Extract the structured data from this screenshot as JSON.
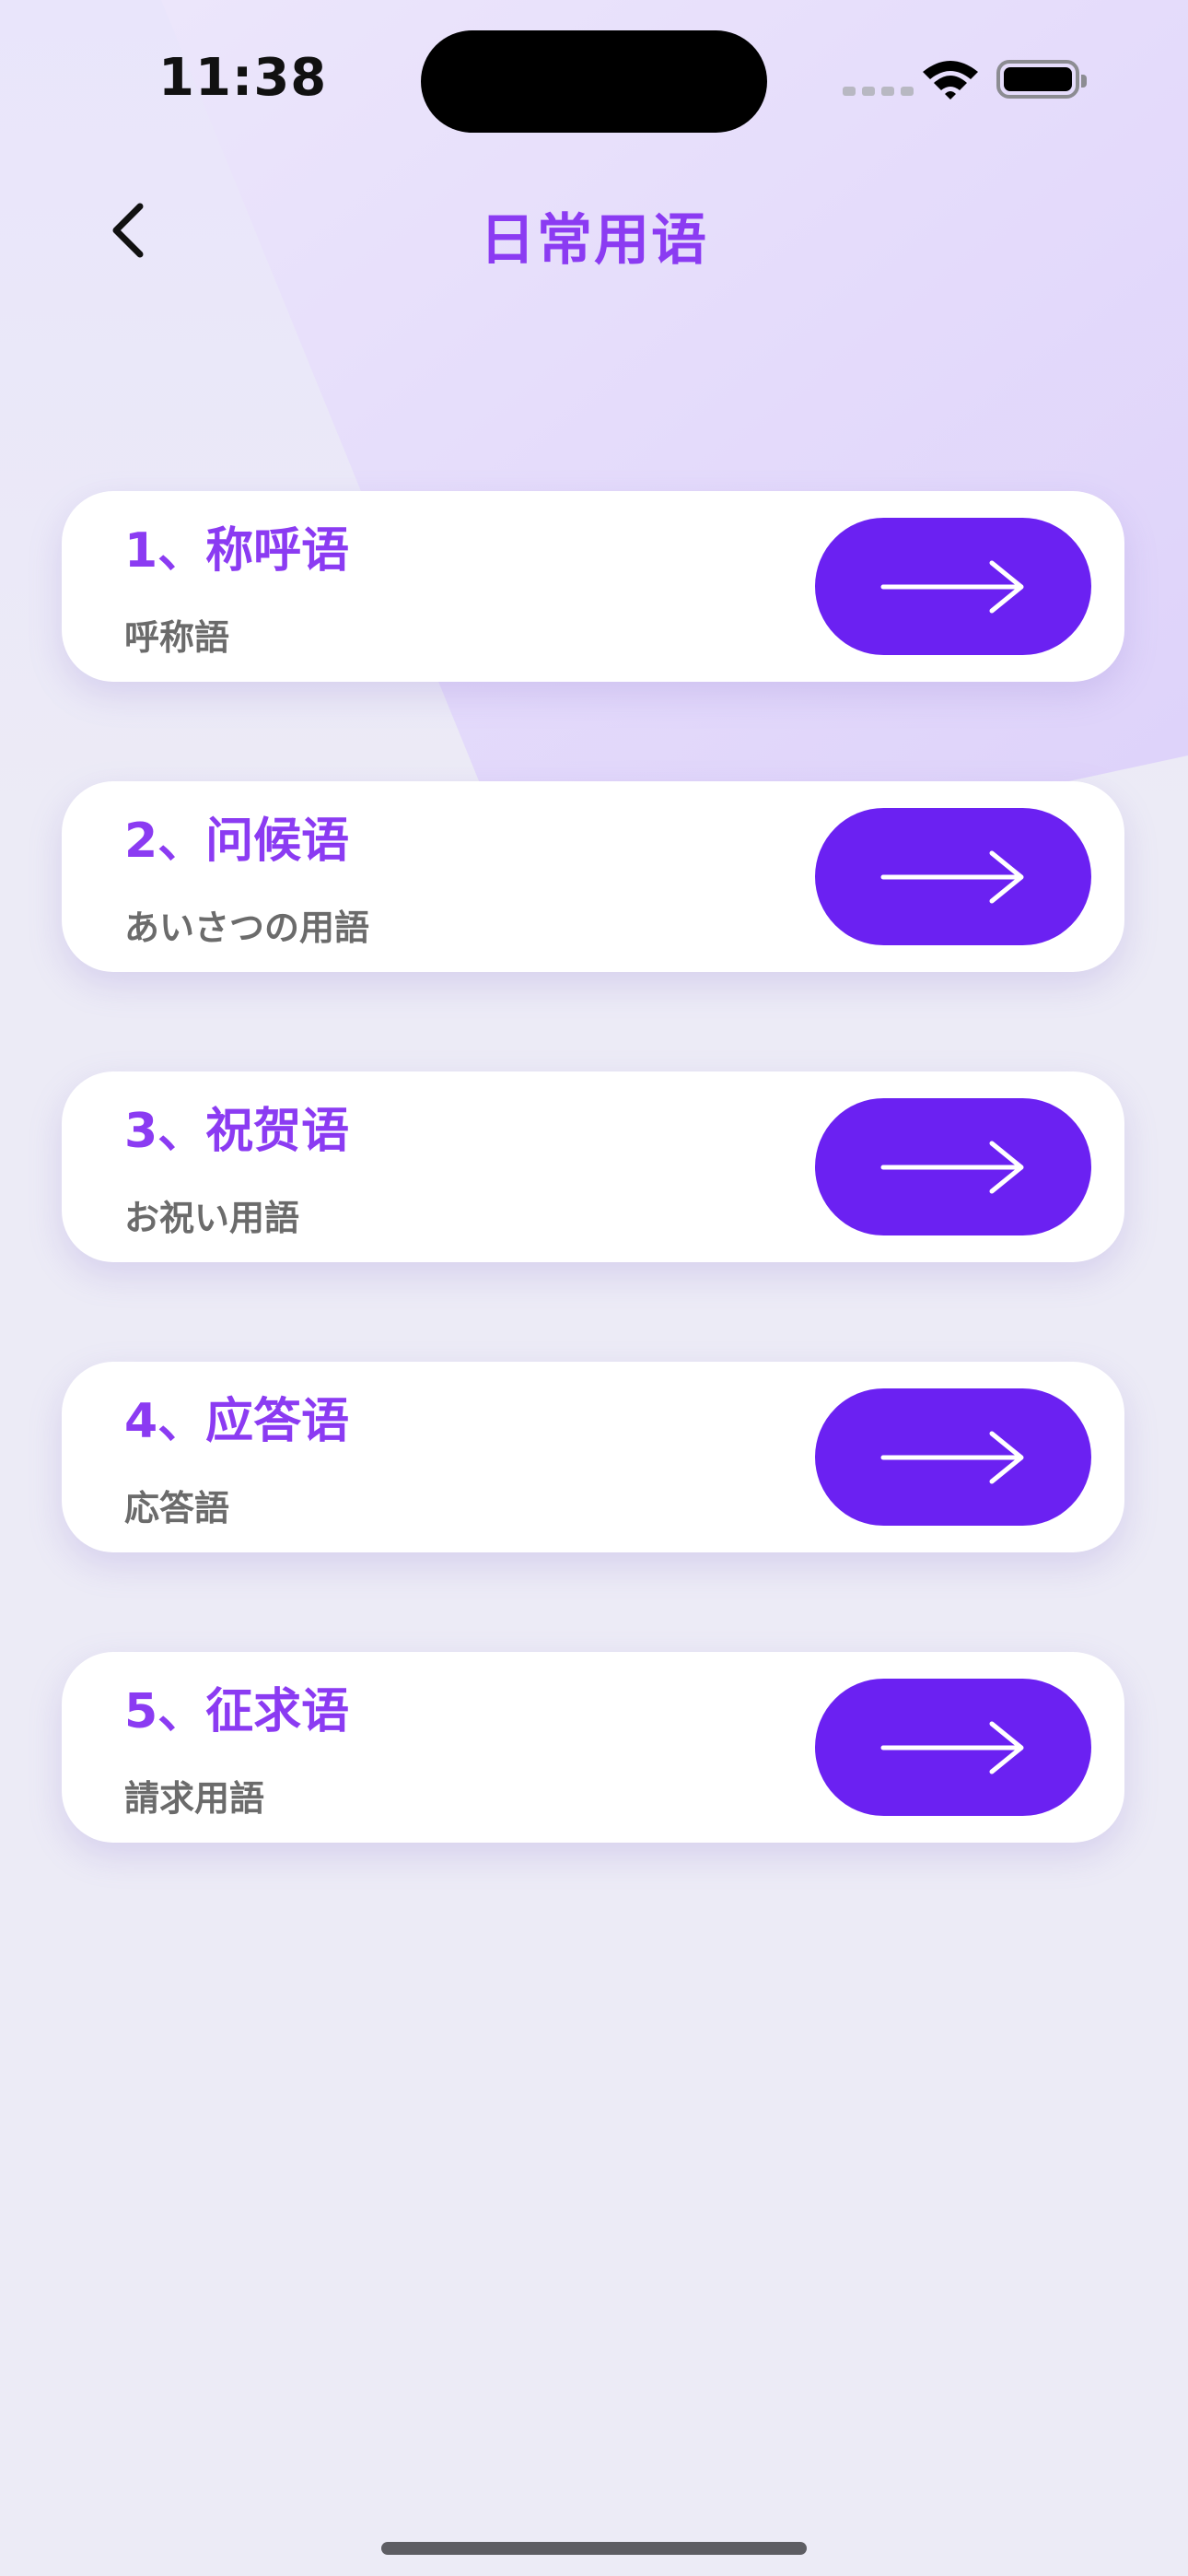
{
  "status_bar": {
    "time": "11:38"
  },
  "nav": {
    "title": "日常用语"
  },
  "colors": {
    "accent": "#8b3bf2",
    "button": "#6b21f2",
    "background": "#ecebf6",
    "subtitle": "#6b6b6b"
  },
  "items": [
    {
      "title": "1、称呼语",
      "subtitle": "呼称語"
    },
    {
      "title": "2、问候语",
      "subtitle": "あいさつの用語"
    },
    {
      "title": "3、祝贺语",
      "subtitle": "お祝い用語"
    },
    {
      "title": "4、应答语",
      "subtitle": "応答語"
    },
    {
      "title": "5、征求语",
      "subtitle": "請求用語"
    }
  ]
}
